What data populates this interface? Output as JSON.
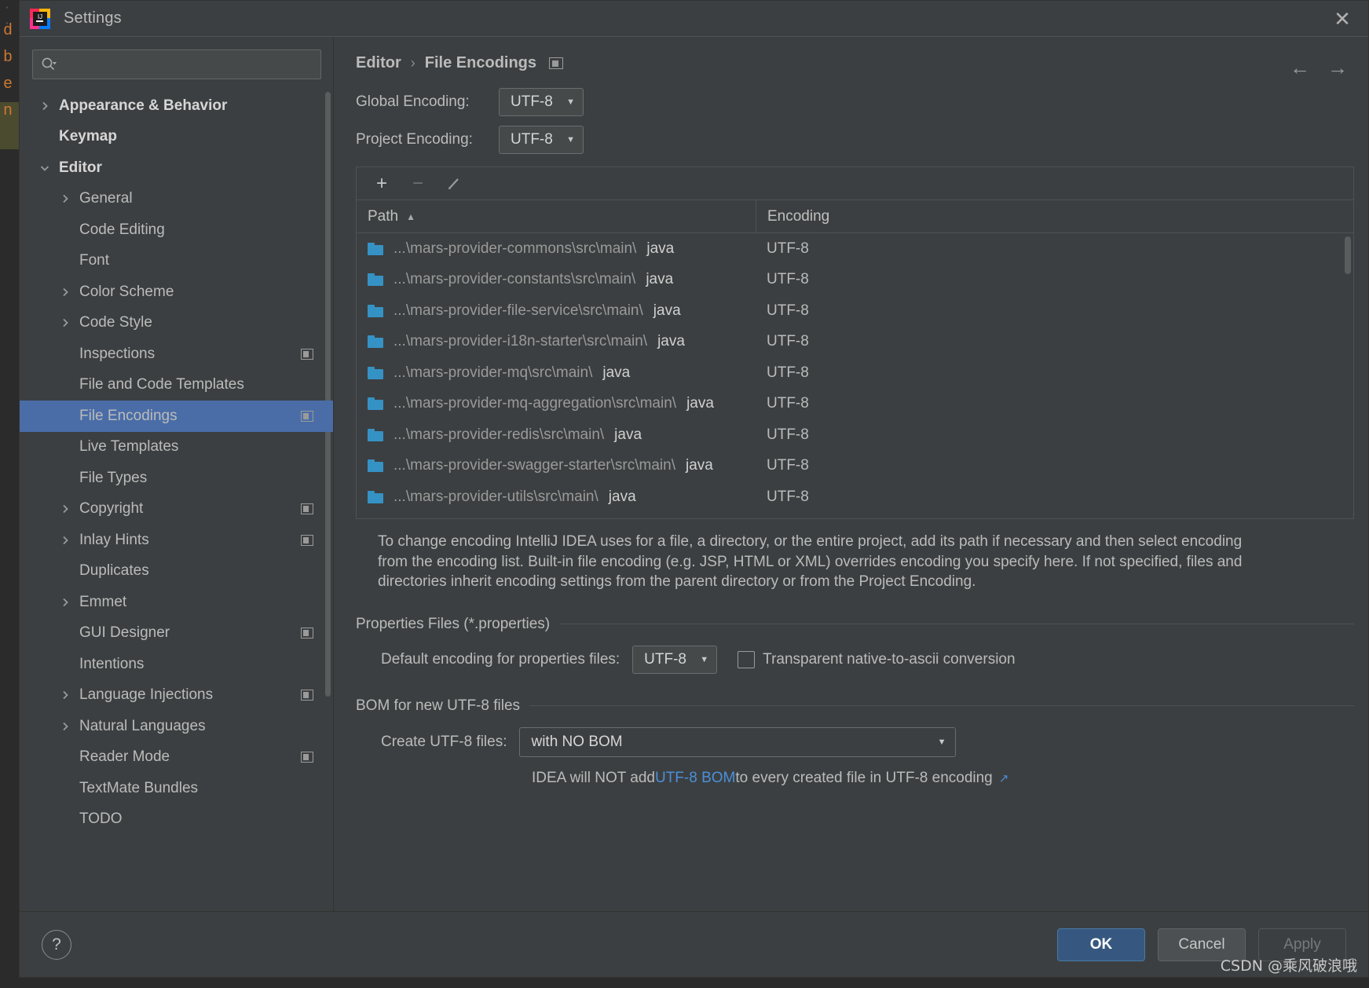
{
  "window": {
    "title": "Settings",
    "logo_icon": "intellij-idea-logo",
    "close_icon": "close-icon"
  },
  "search": {
    "icon": "search-icon",
    "value": "",
    "placeholder": ""
  },
  "sidebar": {
    "scrollbar": "vertical-scrollbar",
    "items": [
      {
        "label": "Appearance & Behavior",
        "indent": 0,
        "arrow": "chevron-right",
        "bold": true,
        "badge": false,
        "selected": false
      },
      {
        "label": "Keymap",
        "indent": 0,
        "arrow": "none",
        "bold": true,
        "badge": false,
        "selected": false
      },
      {
        "label": "Editor",
        "indent": 0,
        "arrow": "chevron-down",
        "bold": true,
        "badge": false,
        "selected": false
      },
      {
        "label": "General",
        "indent": 1,
        "arrow": "chevron-right",
        "bold": false,
        "badge": false,
        "selected": false
      },
      {
        "label": "Code Editing",
        "indent": 1,
        "arrow": "none",
        "bold": false,
        "badge": false,
        "selected": false
      },
      {
        "label": "Font",
        "indent": 1,
        "arrow": "none",
        "bold": false,
        "badge": false,
        "selected": false
      },
      {
        "label": "Color Scheme",
        "indent": 1,
        "arrow": "chevron-right",
        "bold": false,
        "badge": false,
        "selected": false
      },
      {
        "label": "Code Style",
        "indent": 1,
        "arrow": "chevron-right",
        "bold": false,
        "badge": false,
        "selected": false
      },
      {
        "label": "Inspections",
        "indent": 1,
        "arrow": "none",
        "bold": false,
        "badge": true,
        "selected": false
      },
      {
        "label": "File and Code Templates",
        "indent": 1,
        "arrow": "none",
        "bold": false,
        "badge": false,
        "selected": false
      },
      {
        "label": "File Encodings",
        "indent": 1,
        "arrow": "none",
        "bold": false,
        "badge": true,
        "selected": true
      },
      {
        "label": "Live Templates",
        "indent": 1,
        "arrow": "none",
        "bold": false,
        "badge": false,
        "selected": false
      },
      {
        "label": "File Types",
        "indent": 1,
        "arrow": "none",
        "bold": false,
        "badge": false,
        "selected": false
      },
      {
        "label": "Copyright",
        "indent": 1,
        "arrow": "chevron-right",
        "bold": false,
        "badge": true,
        "selected": false
      },
      {
        "label": "Inlay Hints",
        "indent": 1,
        "arrow": "chevron-right",
        "bold": false,
        "badge": true,
        "selected": false
      },
      {
        "label": "Duplicates",
        "indent": 1,
        "arrow": "none",
        "bold": false,
        "badge": false,
        "selected": false
      },
      {
        "label": "Emmet",
        "indent": 1,
        "arrow": "chevron-right",
        "bold": false,
        "badge": false,
        "selected": false
      },
      {
        "label": "GUI Designer",
        "indent": 1,
        "arrow": "none",
        "bold": false,
        "badge": true,
        "selected": false
      },
      {
        "label": "Intentions",
        "indent": 1,
        "arrow": "none",
        "bold": false,
        "badge": false,
        "selected": false
      },
      {
        "label": "Language Injections",
        "indent": 1,
        "arrow": "chevron-right",
        "bold": false,
        "badge": true,
        "selected": false
      },
      {
        "label": "Natural Languages",
        "indent": 1,
        "arrow": "chevron-right",
        "bold": false,
        "badge": false,
        "selected": false
      },
      {
        "label": "Reader Mode",
        "indent": 1,
        "arrow": "none",
        "bold": false,
        "badge": true,
        "selected": false
      },
      {
        "label": "TextMate Bundles",
        "indent": 1,
        "arrow": "none",
        "bold": false,
        "badge": false,
        "selected": false
      },
      {
        "label": "TODO",
        "indent": 1,
        "arrow": "none",
        "bold": false,
        "badge": false,
        "selected": false
      }
    ]
  },
  "breadcrumb": {
    "parent": "Editor",
    "separator": "›",
    "current": "File Encodings",
    "badge_icon": "project-scope-badge-icon",
    "back_icon": "arrow-left-icon",
    "forward_icon": "arrow-right-icon"
  },
  "encodings": {
    "global_label": "Global Encoding:",
    "global_value": "UTF-8",
    "project_label": "Project Encoding:",
    "project_value": "UTF-8"
  },
  "table": {
    "toolbar": {
      "add_icon": "plus-icon",
      "remove_icon": "minus-icon",
      "edit_icon": "pencil-icon"
    },
    "columns": [
      "Path",
      "Encoding"
    ],
    "sort_icon": "sort-ascending-icon",
    "rows": [
      {
        "path": "...\\mars-provider-commons\\src\\main\\",
        "path_tail": "java",
        "encoding": "UTF-8",
        "icon": "folder-icon"
      },
      {
        "path": "...\\mars-provider-constants\\src\\main\\",
        "path_tail": "java",
        "encoding": "UTF-8",
        "icon": "folder-icon"
      },
      {
        "path": "...\\mars-provider-file-service\\src\\main\\",
        "path_tail": "java",
        "encoding": "UTF-8",
        "icon": "folder-icon"
      },
      {
        "path": "...\\mars-provider-i18n-starter\\src\\main\\",
        "path_tail": "java",
        "encoding": "UTF-8",
        "icon": "folder-icon"
      },
      {
        "path": "...\\mars-provider-mq\\src\\main\\",
        "path_tail": "java",
        "encoding": "UTF-8",
        "icon": "folder-icon"
      },
      {
        "path": "...\\mars-provider-mq-aggregation\\src\\main\\",
        "path_tail": "java",
        "encoding": "UTF-8",
        "icon": "folder-icon"
      },
      {
        "path": "...\\mars-provider-redis\\src\\main\\",
        "path_tail": "java",
        "encoding": "UTF-8",
        "icon": "folder-icon"
      },
      {
        "path": "...\\mars-provider-swagger-starter\\src\\main\\",
        "path_tail": "java",
        "encoding": "UTF-8",
        "icon": "folder-icon"
      },
      {
        "path": "...\\mars-provider-utils\\src\\main\\",
        "path_tail": "java",
        "encoding": "UTF-8",
        "icon": "folder-icon"
      }
    ]
  },
  "help_text": "To change encoding IntelliJ IDEA uses for a file, a directory, or the entire project, add its path if necessary and then select encoding from the encoding list. Built-in file encoding (e.g. JSP, HTML or XML) overrides encoding you specify here. If not specified, files and directories inherit encoding settings from the parent directory or from the Project Encoding.",
  "properties_section": {
    "title": "Properties Files (*.properties)",
    "default_encoding_label": "Default encoding for properties files:",
    "default_encoding_value": "UTF-8",
    "transparent_label": "Transparent native-to-ascii conversion",
    "transparent_checked": false
  },
  "bom_section": {
    "title": "BOM for new UTF-8 files",
    "create_label": "Create UTF-8 files:",
    "create_value": "with NO BOM",
    "note_prefix": "IDEA will NOT add ",
    "note_link": "UTF-8 BOM",
    "note_suffix": " to every created file in UTF-8 encoding",
    "external_link_icon": "external-link-icon"
  },
  "footer": {
    "help_icon": "help-question-icon",
    "ok_label": "OK",
    "cancel_label": "Cancel",
    "apply_label": "Apply"
  },
  "watermark": "CSDN @乘风破浪哦",
  "colors": {
    "accent_blue": "#4a6da7",
    "ok_button": "#365880",
    "link": "#4a90d9",
    "folder": "#3592c4",
    "panel_bg": "#3c3f41",
    "field_bg": "#45494a"
  }
}
